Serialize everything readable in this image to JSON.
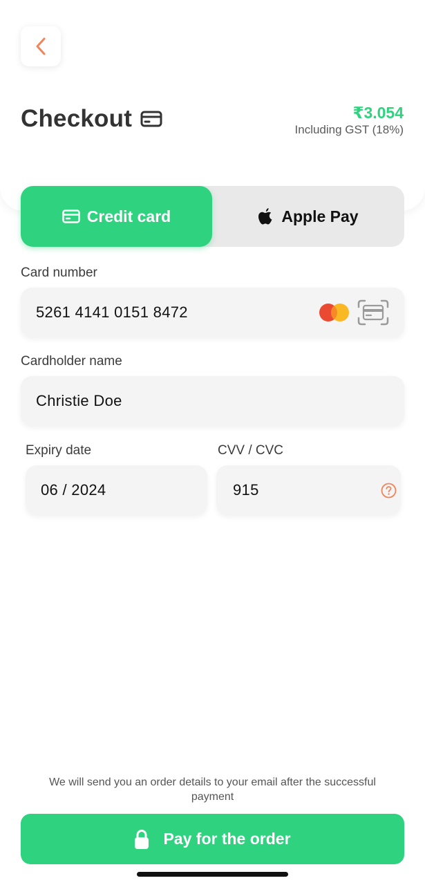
{
  "header": {
    "title": "Checkout",
    "title_icon": "credit-card-icon",
    "back_icon": "chevron-left-icon",
    "price": "₹3.054",
    "tax_note": "Including GST (18%)"
  },
  "payment_methods": {
    "selected": "Credit card",
    "tabs": [
      {
        "label": "Credit card",
        "icon": "credit-card-icon",
        "active": true
      },
      {
        "label": "Apple Pay",
        "icon": "apple-icon",
        "active": false
      }
    ]
  },
  "form": {
    "card_number": {
      "label": "Card number",
      "value": "5261 4141 0151 8472",
      "brand_icon": "mastercard-icon",
      "scan_icon": "card-scan-icon"
    },
    "cardholder": {
      "label": "Cardholder name",
      "value": "Christie Doe"
    },
    "expiry": {
      "label": "Expiry date",
      "value": "06 / 2024"
    },
    "cvv": {
      "label": "CVV / CVC",
      "value": "915",
      "help_icon": "help-icon"
    }
  },
  "footer": {
    "note": "We will send you an order details to your email after the successful payment",
    "pay_label": "Pay for the order",
    "pay_icon": "lock-icon"
  },
  "colors": {
    "accent": "#2ED27F",
    "back_arrow": "#F0845A",
    "field_bg": "#F4F4F4",
    "inactive_tab_bg": "#E9E9E9",
    "mastercard_red": "#EB4A32",
    "mastercard_yellow": "#F9B824"
  }
}
